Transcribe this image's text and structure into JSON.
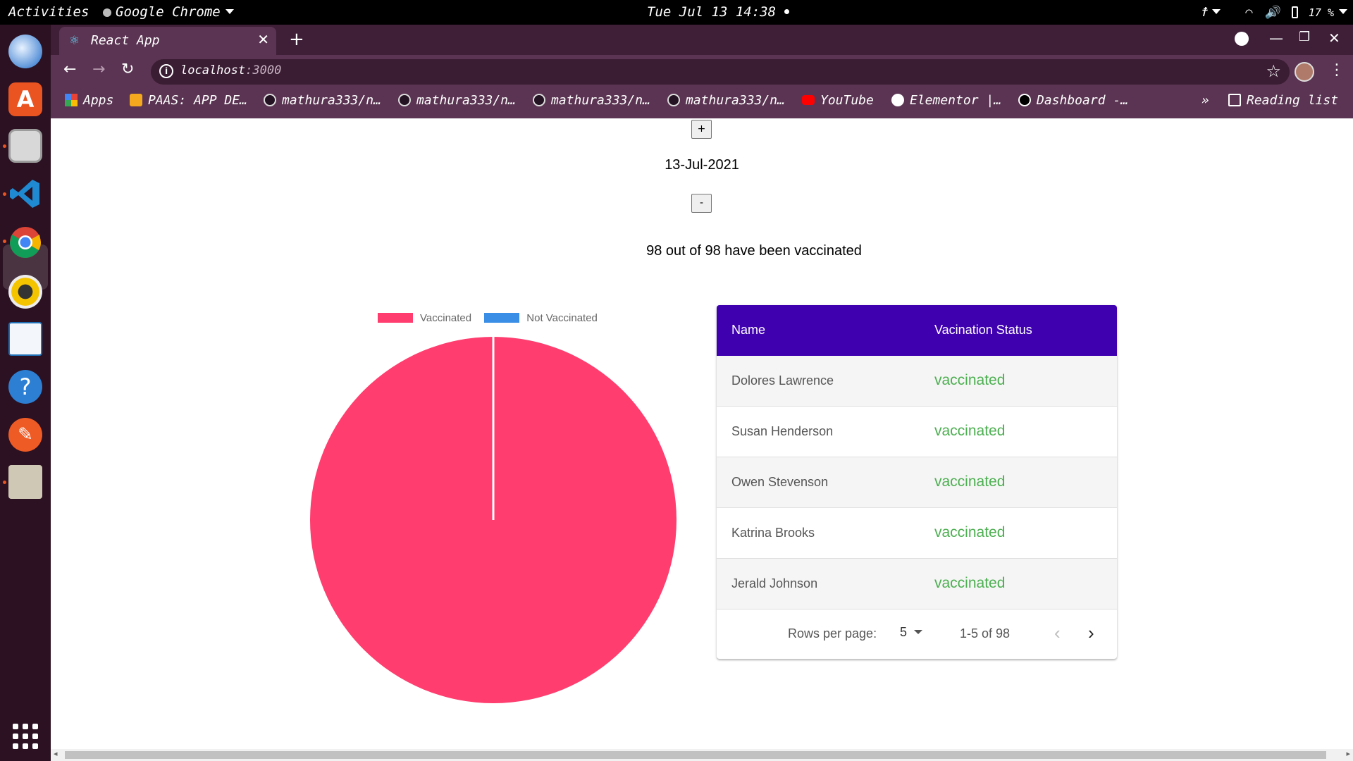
{
  "topbar": {
    "activities": "Activities",
    "app_menu": "Google Chrome",
    "clock": "Tue Jul 13 14:38",
    "battery": "17 %"
  },
  "dock": {
    "items": [
      "thunderbird-icon",
      "software-center-icon",
      "files-icon",
      "vscode-icon",
      "chrome-icon",
      "rhythmbox-icon",
      "writer-icon",
      "help-icon",
      "postman-icon",
      "archive-icon"
    ]
  },
  "browser": {
    "tab_title": "React App",
    "url_host": "localhost",
    "url_port": ":3000",
    "bookmarks": [
      "Apps",
      "PAAS: APP DE…",
      "mathura333/n…",
      "mathura333/n…",
      "mathura333/n…",
      "mathura333/n…",
      "YouTube",
      "Elementor |…",
      "Dashboard -…"
    ],
    "overflow": "»",
    "reading_list": "Reading list"
  },
  "page": {
    "increment_label": "+",
    "decrement_label": "-",
    "date": "13-Jul-2021",
    "summary": "98 out of 98 have been vaccinated"
  },
  "chart_data": {
    "type": "pie",
    "categories": [
      "Vaccinated",
      "Not Vaccinated"
    ],
    "values": [
      98,
      0
    ],
    "colors": [
      "#ff3d6e",
      "#3a8ee6"
    ],
    "legend_position": "top"
  },
  "table": {
    "headers": [
      "Name",
      "Vacination Status"
    ],
    "rows": [
      {
        "name": "Dolores Lawrence",
        "status": "vaccinated"
      },
      {
        "name": "Susan Henderson",
        "status": "vaccinated"
      },
      {
        "name": "Owen Stevenson",
        "status": "vaccinated"
      },
      {
        "name": "Katrina Brooks",
        "status": "vaccinated"
      },
      {
        "name": "Jerald Johnson",
        "status": "vaccinated"
      }
    ],
    "rows_per_page_label": "Rows per page:",
    "rows_per_page": "5",
    "range": "1-5 of 98",
    "status_color": "#4caf50",
    "header_color": "#3f00b0"
  }
}
